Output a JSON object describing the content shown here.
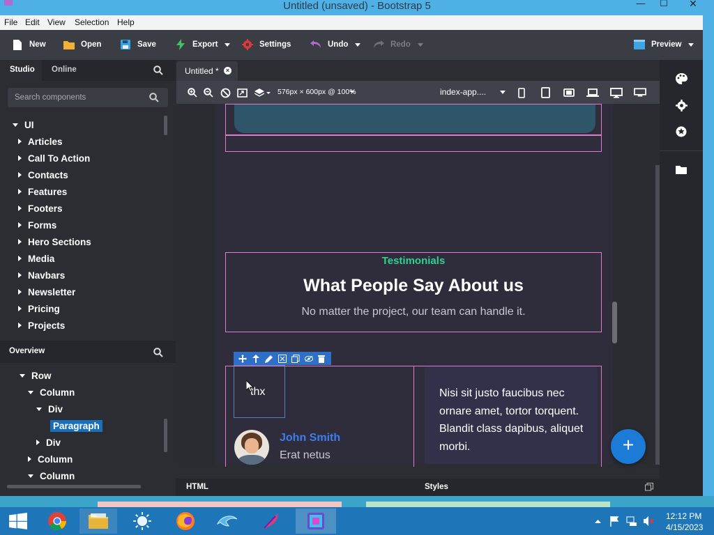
{
  "window": {
    "title": "Untitled (unsaved) - Bootstrap 5",
    "minimize": "—",
    "maximize": "☐",
    "close": "✕"
  },
  "menu": [
    "File",
    "Edit",
    "View",
    "Selection",
    "Help"
  ],
  "toolbar": {
    "new": "New",
    "open": "Open",
    "save": "Save",
    "export": "Export",
    "settings": "Settings",
    "undo": "Undo",
    "redo": "Redo",
    "preview": "Preview"
  },
  "left_tabs": {
    "studio": "Studio",
    "online": "Online"
  },
  "search": {
    "placeholder": "Search components"
  },
  "tree": {
    "root": "UI",
    "items": [
      "Articles",
      "Call To Action",
      "Contacts",
      "Features",
      "Footers",
      "Forms",
      "Hero Sections",
      "Media",
      "Navbars",
      "Newsletter",
      "Pricing",
      "Projects"
    ]
  },
  "overview": {
    "title": "Overview",
    "items": [
      {
        "label": "Row",
        "indent": 1,
        "expanded": true
      },
      {
        "label": "Column",
        "indent": 2,
        "expanded": true
      },
      {
        "label": "Div",
        "indent": 3,
        "expanded": true
      },
      {
        "label": "Paragraph",
        "indent": 4,
        "selected": true
      },
      {
        "label": "Div",
        "indent": 3,
        "expanded": false
      },
      {
        "label": "Column",
        "indent": 2,
        "expanded": false
      },
      {
        "label": "Column",
        "indent": 2,
        "expanded": true
      }
    ]
  },
  "doc_tab": {
    "label": "Untitled *"
  },
  "canvas_bar": {
    "viewport": "576px × 600px @ 100%",
    "file": "index-app...."
  },
  "page": {
    "eyebrow": "Testimonials",
    "heading": "What People Say About us",
    "subheading": "No matter the project, our team can handle it.",
    "selected_text": "thx",
    "person_name": "John Smith",
    "person_role": "Erat netus",
    "quote": "Nisi sit justo faucibus nec ornare amet, tortor torquent. Blandit class dapibus, aliquet morbi."
  },
  "bottom_tabs": {
    "html": "HTML",
    "styles": "Styles"
  },
  "colors": {
    "accent": "#1b7bd6",
    "eyebrow": "#2fd28f",
    "name": "#3e7cf0",
    "selection_outline": "#e07bd0"
  },
  "taskbar": {
    "time": "12:12 PM",
    "date": "4/15/2023"
  }
}
